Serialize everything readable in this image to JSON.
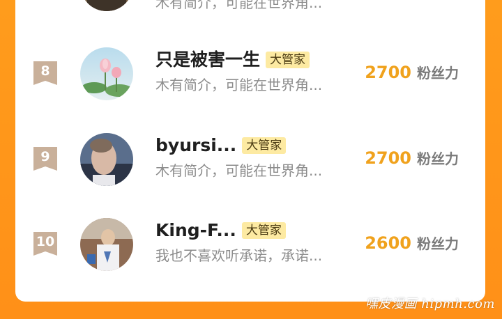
{
  "ranking": {
    "rows": [
      {
        "rank": "",
        "name": "",
        "badge": "",
        "description": "木有简介，可能在世界角...",
        "fans_value": "",
        "fans_label": ""
      },
      {
        "rank": "8",
        "name": "只是被害一生",
        "badge": "大管家",
        "description": "木有简介，可能在世界角...",
        "fans_value": "2700",
        "fans_label": "粉丝力"
      },
      {
        "rank": "9",
        "name": "byursi...",
        "badge": "大管家",
        "description": "木有简介，可能在世界角...",
        "fans_value": "2700",
        "fans_label": "粉丝力"
      },
      {
        "rank": "10",
        "name": "King-F...",
        "badge": "大管家",
        "description": "我也不喜欢听承诺，承诺...",
        "fans_value": "2600",
        "fans_label": "粉丝力"
      }
    ]
  },
  "watermark": "嘿皮漫画 hipmh.com",
  "colors": {
    "background_orange": "#ff9a1f",
    "fans_value": "#f0a21d",
    "badge_bg": "#fdeaa2",
    "rank_ribbon": "#c9b09a"
  },
  "icons": {
    "rank_marker": "ribbon-bookmark-icon"
  }
}
